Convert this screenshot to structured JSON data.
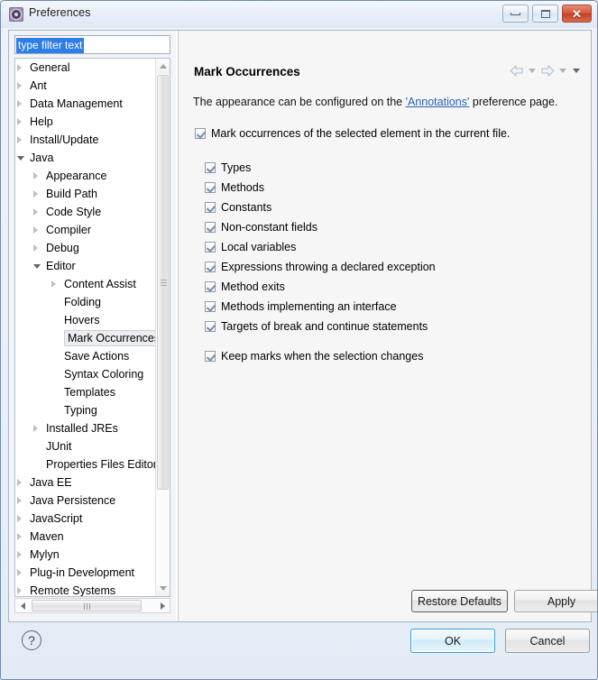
{
  "window": {
    "title": "Preferences",
    "icon": "preferences-gear-icon",
    "controls": {
      "minimize": "minimize-icon",
      "maximize": "restore-icon",
      "close": "✕"
    }
  },
  "filter": {
    "value": "type filter text",
    "placeholder": "type filter text"
  },
  "tree": {
    "items": [
      {
        "label": "General",
        "indent": 0,
        "state": "collapsed",
        "selected": false
      },
      {
        "label": "Ant",
        "indent": 0,
        "state": "collapsed",
        "selected": false
      },
      {
        "label": "Data Management",
        "indent": 0,
        "state": "collapsed",
        "selected": false
      },
      {
        "label": "Help",
        "indent": 0,
        "state": "collapsed",
        "selected": false
      },
      {
        "label": "Install/Update",
        "indent": 0,
        "state": "collapsed",
        "selected": false
      },
      {
        "label": "Java",
        "indent": 0,
        "state": "expanded",
        "selected": false
      },
      {
        "label": "Appearance",
        "indent": 1,
        "state": "collapsed",
        "selected": false
      },
      {
        "label": "Build Path",
        "indent": 1,
        "state": "collapsed",
        "selected": false
      },
      {
        "label": "Code Style",
        "indent": 1,
        "state": "collapsed",
        "selected": false
      },
      {
        "label": "Compiler",
        "indent": 1,
        "state": "collapsed",
        "selected": false
      },
      {
        "label": "Debug",
        "indent": 1,
        "state": "collapsed",
        "selected": false
      },
      {
        "label": "Editor",
        "indent": 1,
        "state": "expanded",
        "selected": false
      },
      {
        "label": "Content Assist",
        "indent": 2,
        "state": "collapsed",
        "selected": false
      },
      {
        "label": "Folding",
        "indent": 2,
        "state": "leaf",
        "selected": false
      },
      {
        "label": "Hovers",
        "indent": 2,
        "state": "leaf",
        "selected": false
      },
      {
        "label": "Mark Occurrences",
        "indent": 2,
        "state": "leaf",
        "selected": true
      },
      {
        "label": "Save Actions",
        "indent": 2,
        "state": "leaf",
        "selected": false
      },
      {
        "label": "Syntax Coloring",
        "indent": 2,
        "state": "leaf",
        "selected": false
      },
      {
        "label": "Templates",
        "indent": 2,
        "state": "leaf",
        "selected": false
      },
      {
        "label": "Typing",
        "indent": 2,
        "state": "leaf",
        "selected": false
      },
      {
        "label": "Installed JREs",
        "indent": 1,
        "state": "collapsed",
        "selected": false
      },
      {
        "label": "JUnit",
        "indent": 1,
        "state": "leaf",
        "selected": false
      },
      {
        "label": "Properties Files Editor",
        "indent": 1,
        "state": "leaf",
        "selected": false
      },
      {
        "label": "Java EE",
        "indent": 0,
        "state": "collapsed",
        "selected": false
      },
      {
        "label": "Java Persistence",
        "indent": 0,
        "state": "collapsed",
        "selected": false
      },
      {
        "label": "JavaScript",
        "indent": 0,
        "state": "collapsed",
        "selected": false
      },
      {
        "label": "Maven",
        "indent": 0,
        "state": "collapsed",
        "selected": false
      },
      {
        "label": "Mylyn",
        "indent": 0,
        "state": "collapsed",
        "selected": false
      },
      {
        "label": "Plug-in Development",
        "indent": 0,
        "state": "collapsed",
        "selected": false
      },
      {
        "label": "Remote Systems",
        "indent": 0,
        "state": "collapsed",
        "selected": false
      }
    ]
  },
  "page": {
    "title": "Mark Occurrences",
    "description_before": "The appearance can be configured on the ",
    "description_link": "'Annotations'",
    "description_after": " preference page.",
    "master_checkbox": {
      "label": "Mark occurrences of the selected element in the current file.",
      "checked": true
    },
    "options": [
      {
        "label": "Types",
        "checked": true
      },
      {
        "label": "Methods",
        "checked": true
      },
      {
        "label": "Constants",
        "checked": true
      },
      {
        "label": "Non-constant fields",
        "checked": true
      },
      {
        "label": "Local variables",
        "checked": true
      },
      {
        "label": "Expressions throwing a declared exception",
        "checked": true
      },
      {
        "label": "Method exits",
        "checked": true
      },
      {
        "label": "Methods implementing an interface",
        "checked": true
      },
      {
        "label": "Targets of break and continue statements",
        "checked": true
      }
    ],
    "keep_marks": {
      "label": "Keep marks when the selection changes",
      "checked": true
    },
    "buttons": {
      "restore_defaults": "Restore Defaults",
      "apply": "Apply"
    },
    "nav": {
      "back": "back-arrow-icon",
      "forward": "forward-arrow-icon",
      "menu": "dropdown-menu-icon"
    }
  },
  "footer": {
    "help": "?",
    "ok": "OK",
    "cancel": "Cancel"
  },
  "colors": {
    "accent": "#2f7ee8",
    "link": "#2a5fb5",
    "default_button_border": "#3c9cd6",
    "close_button": "#c23f25"
  }
}
